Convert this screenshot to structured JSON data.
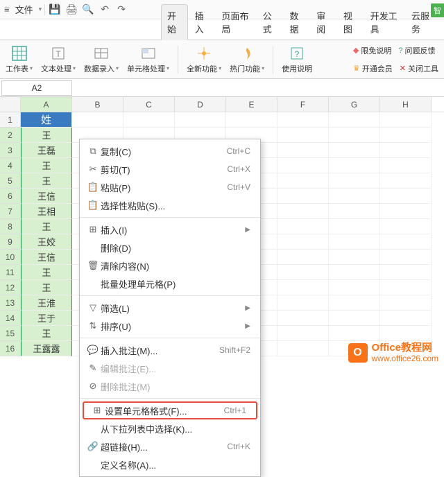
{
  "titlebar": {
    "file_label": "文件",
    "smart_tag": "智"
  },
  "tabs": [
    "开始",
    "插入",
    "页面布局",
    "公式",
    "数据",
    "审阅",
    "视图",
    "开发工具",
    "云服务"
  ],
  "active_tab": 0,
  "ribbon": {
    "items": [
      {
        "label": "工作表"
      },
      {
        "label": "文本处理"
      },
      {
        "label": "数据录入"
      },
      {
        "label": "单元格处理"
      },
      {
        "label": "全新功能"
      },
      {
        "label": "热门功能"
      },
      {
        "label": "使用说明"
      }
    ],
    "right": {
      "r1a": "限免说明",
      "r1b": "问题反馈",
      "r2a": "开通会员",
      "r2b": "关闭工具"
    }
  },
  "namebox": {
    "value": "A2"
  },
  "columns": [
    "A",
    "B",
    "C",
    "D",
    "E",
    "F",
    "G",
    "H"
  ],
  "rows": [
    {
      "n": "1",
      "a": "姓",
      "header": true
    },
    {
      "n": "2",
      "a": "王"
    },
    {
      "n": "3",
      "a": "王磊"
    },
    {
      "n": "4",
      "a": "王"
    },
    {
      "n": "5",
      "a": "王"
    },
    {
      "n": "6",
      "a": "王信"
    },
    {
      "n": "7",
      "a": "王相"
    },
    {
      "n": "8",
      "a": "王"
    },
    {
      "n": "9",
      "a": "王姣"
    },
    {
      "n": "10",
      "a": "王信"
    },
    {
      "n": "11",
      "a": "王"
    },
    {
      "n": "12",
      "a": "王"
    },
    {
      "n": "13",
      "a": "王淮"
    },
    {
      "n": "14",
      "a": "王于"
    },
    {
      "n": "15",
      "a": "王"
    },
    {
      "n": "16",
      "a": "王露露"
    }
  ],
  "context_menu": [
    {
      "icon": "copy",
      "label": "复制(C)",
      "shortcut": "Ctrl+C"
    },
    {
      "icon": "cut",
      "label": "剪切(T)",
      "shortcut": "Ctrl+X"
    },
    {
      "icon": "paste",
      "label": "粘贴(P)",
      "shortcut": "Ctrl+V"
    },
    {
      "icon": "pastespecial",
      "label": "选择性粘贴(S)..."
    },
    {
      "sep": true
    },
    {
      "icon": "insert",
      "label": "插入(I)",
      "sub": true
    },
    {
      "icon": "",
      "label": "删除(D)"
    },
    {
      "icon": "clear",
      "label": "清除内容(N)"
    },
    {
      "icon": "",
      "label": "批量处理单元格(P)"
    },
    {
      "sep": true
    },
    {
      "icon": "filter",
      "label": "筛选(L)",
      "sub": true
    },
    {
      "icon": "sort",
      "label": "排序(U)",
      "sub": true
    },
    {
      "sep": true
    },
    {
      "icon": "comment",
      "label": "插入批注(M)...",
      "shortcut": "Shift+F2"
    },
    {
      "icon": "editcomment",
      "label": "编辑批注(E)...",
      "disabled": true
    },
    {
      "icon": "delcomment",
      "label": "删除批注(M)",
      "disabled": true
    },
    {
      "sep": true
    },
    {
      "icon": "format",
      "label": "设置单元格格式(F)...",
      "shortcut": "Ctrl+1",
      "highlight": true
    },
    {
      "icon": "",
      "label": "从下拉列表中选择(K)..."
    },
    {
      "icon": "link",
      "label": "超链接(H)...",
      "shortcut": "Ctrl+K"
    },
    {
      "icon": "",
      "label": "定义名称(A)..."
    }
  ],
  "watermark": {
    "t1": "Office教程网",
    "t2": "www.office26.com"
  }
}
